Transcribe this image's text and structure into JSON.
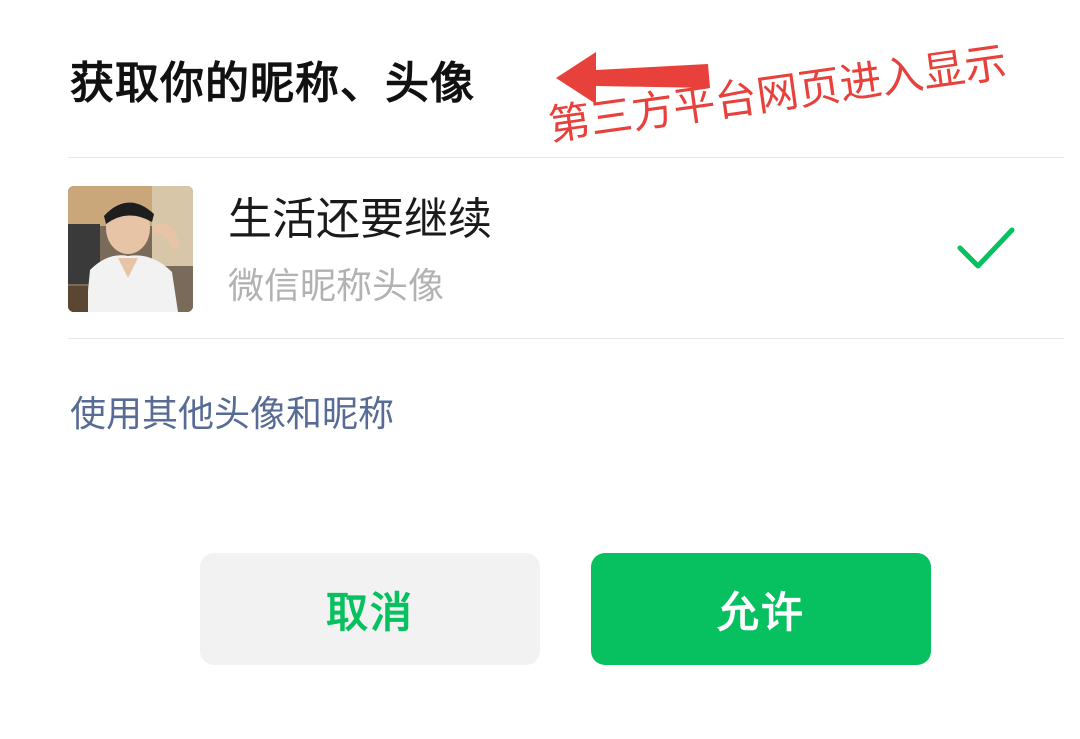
{
  "dialog": {
    "title": "获取你的昵称、头像",
    "account": {
      "nickname": "生活还要继续",
      "subtitle": "微信昵称头像",
      "selected": true
    },
    "other_option": "使用其他头像和昵称",
    "buttons": {
      "cancel": "取消",
      "allow": "允许"
    }
  },
  "annotation": {
    "text": "第三方平台网页进入显示"
  },
  "colors": {
    "accent_green": "#07c160",
    "link_blue": "#576b95",
    "annotation_red": "#e8413c",
    "secondary_text": "#b2b2b2"
  },
  "icons": {
    "selected": "check-icon",
    "annotation": "arrow-left-icon"
  }
}
